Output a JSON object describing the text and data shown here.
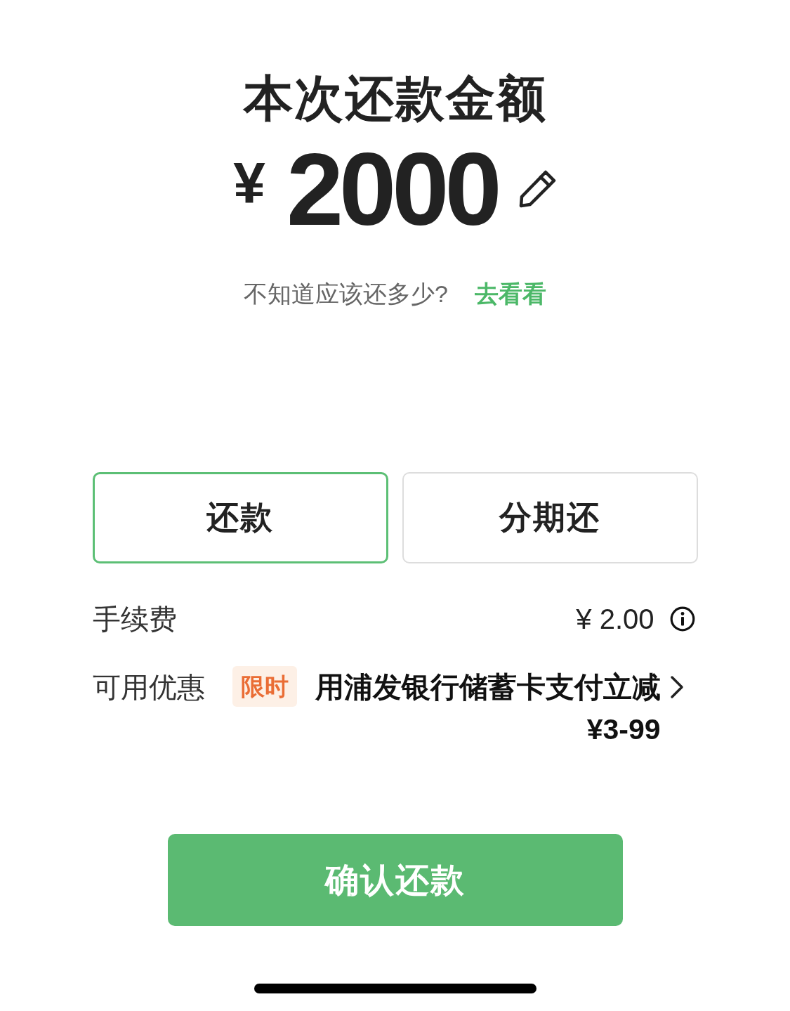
{
  "title": "本次还款金额",
  "amount": {
    "currency": "¥",
    "value": "2000"
  },
  "hint": {
    "question": "不知道应该还多少?",
    "link": "去看看"
  },
  "tabs": [
    {
      "label": "还款",
      "selected": true
    },
    {
      "label": "分期还",
      "selected": false
    }
  ],
  "fee": {
    "label": "手续费",
    "value": "¥ 2.00"
  },
  "discount": {
    "label": "可用优惠",
    "tag": "限时",
    "text": "用浦发银行储蓄卡支付立减¥3-99"
  },
  "confirm_button": "确认还款"
}
